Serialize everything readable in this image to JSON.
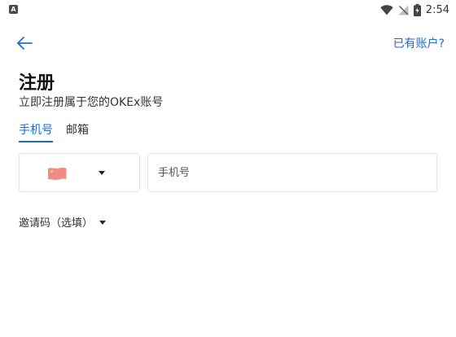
{
  "status_bar": {
    "notification_icon_letter": "A",
    "time": "2:54",
    "icons": [
      "wifi-icon",
      "no-signal-icon",
      "battery-icon"
    ]
  },
  "header": {
    "back_icon": "arrow-left-icon",
    "login_link": "已有账户?"
  },
  "page": {
    "title": "注册",
    "subtitle": "立即注册属于您的OKEx账号"
  },
  "tabs": [
    {
      "label": "手机号",
      "active": true
    },
    {
      "label": "邮箱",
      "active": false
    }
  ],
  "phone": {
    "country_flag": "china-flag-icon",
    "placeholder": "手机号",
    "value": ""
  },
  "invite": {
    "label": "邀请码（选填）"
  },
  "colors": {
    "accent": "#1f6bd6",
    "border": "#e4e4e4",
    "flag_red": "#f28b82"
  }
}
